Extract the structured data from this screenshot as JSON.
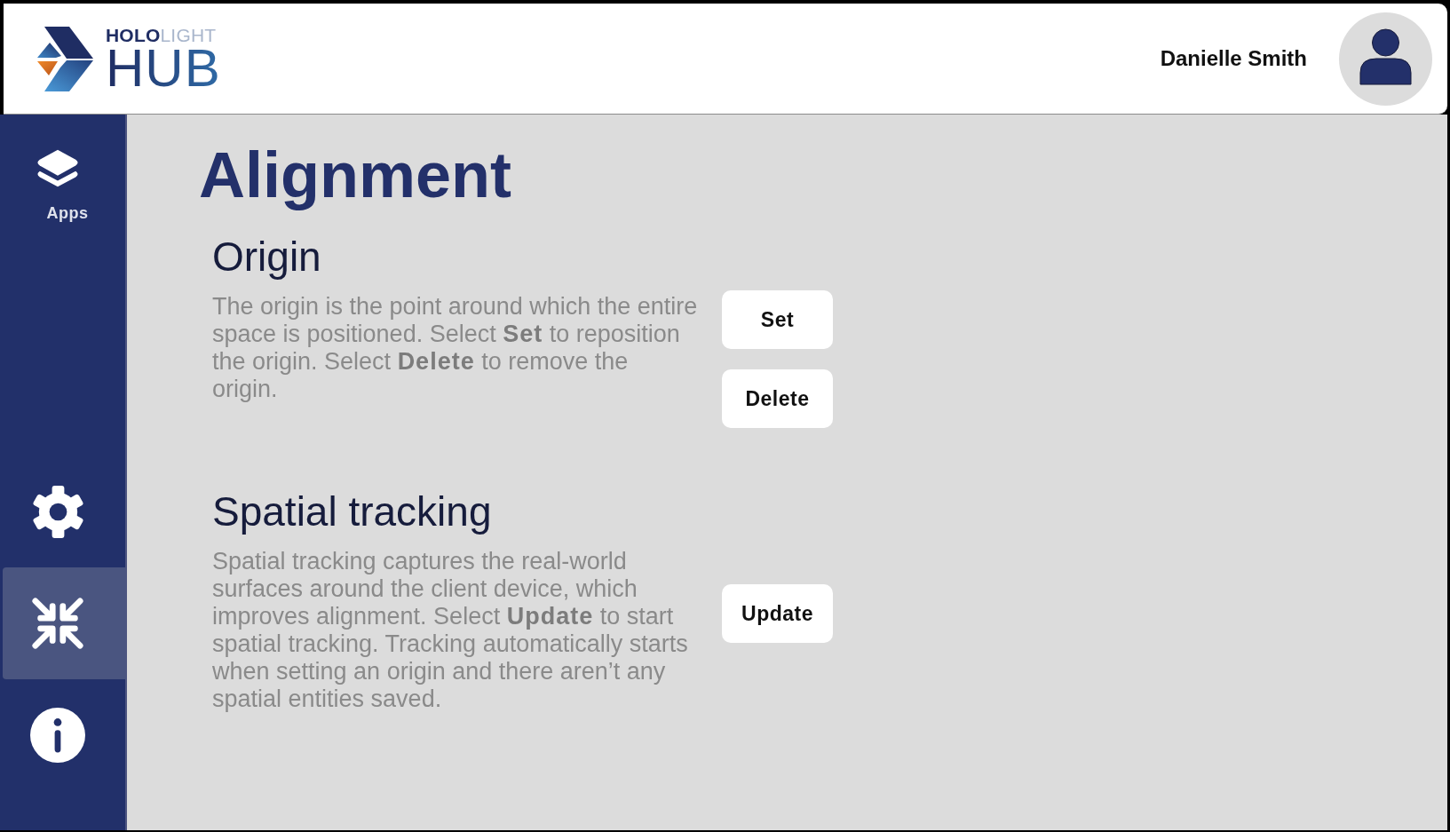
{
  "header": {
    "logo": {
      "wordmark": "**HOLO**LIGHT",
      "product": "HUB"
    },
    "user": {
      "name": "Danielle Smith"
    }
  },
  "sidebar": {
    "items": [
      {
        "kind": "apps",
        "label": "Apps",
        "selected": false
      },
      {
        "kind": "settings",
        "selected": false
      },
      {
        "kind": "alignment",
        "selected": true
      },
      {
        "kind": "info",
        "selected": false
      }
    ]
  },
  "page": {
    "title": "Alignment",
    "sections": [
      {
        "heading": "Origin",
        "description": "The origin is the point around which the entire space is positioned. Select **Set** to reposition the origin. Select **Delete** to remove the origin.",
        "buttons": [
          "Set",
          "Delete"
        ]
      },
      {
        "heading": "Spatial tracking",
        "description": "Spatial tracking captures the real-world surfaces around the client device, which improves alignment. Select **Update** to start spatial tracking. Tracking automatically starts when setting an origin and there aren’t any spatial entities saved.",
        "buttons": [
          "Update"
        ]
      }
    ]
  }
}
